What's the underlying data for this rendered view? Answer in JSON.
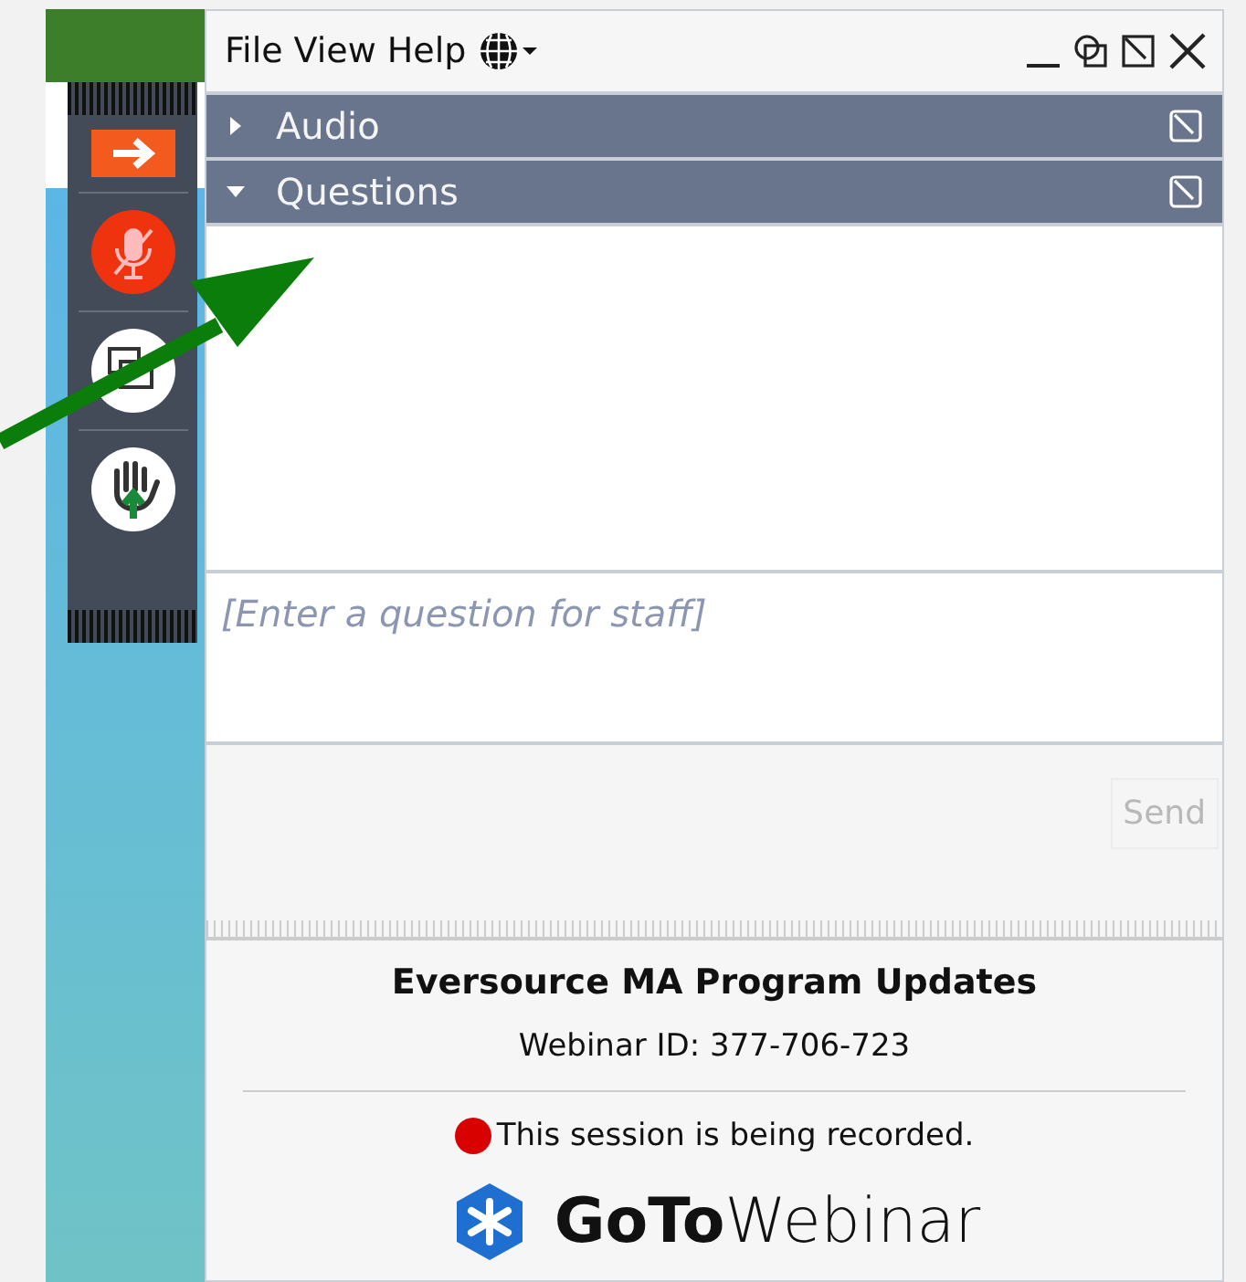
{
  "menu": [
    "File",
    "View",
    "Help"
  ],
  "panes": [
    {
      "title": "Audio",
      "expanded": false
    },
    {
      "title": "Questions",
      "expanded": true
    }
  ],
  "question_field": {
    "placeholder": "[Enter a question for staff]"
  },
  "send_button": {
    "label": "Send",
    "disabled": true
  },
  "session": {
    "title": "Eversource MA Program Updates",
    "webinar_id": "Webinar ID: 377-706-723",
    "recording": true,
    "recording_notice": "This session is being recorded.",
    "logo": "**GoTo**Webinar"
  }
}
